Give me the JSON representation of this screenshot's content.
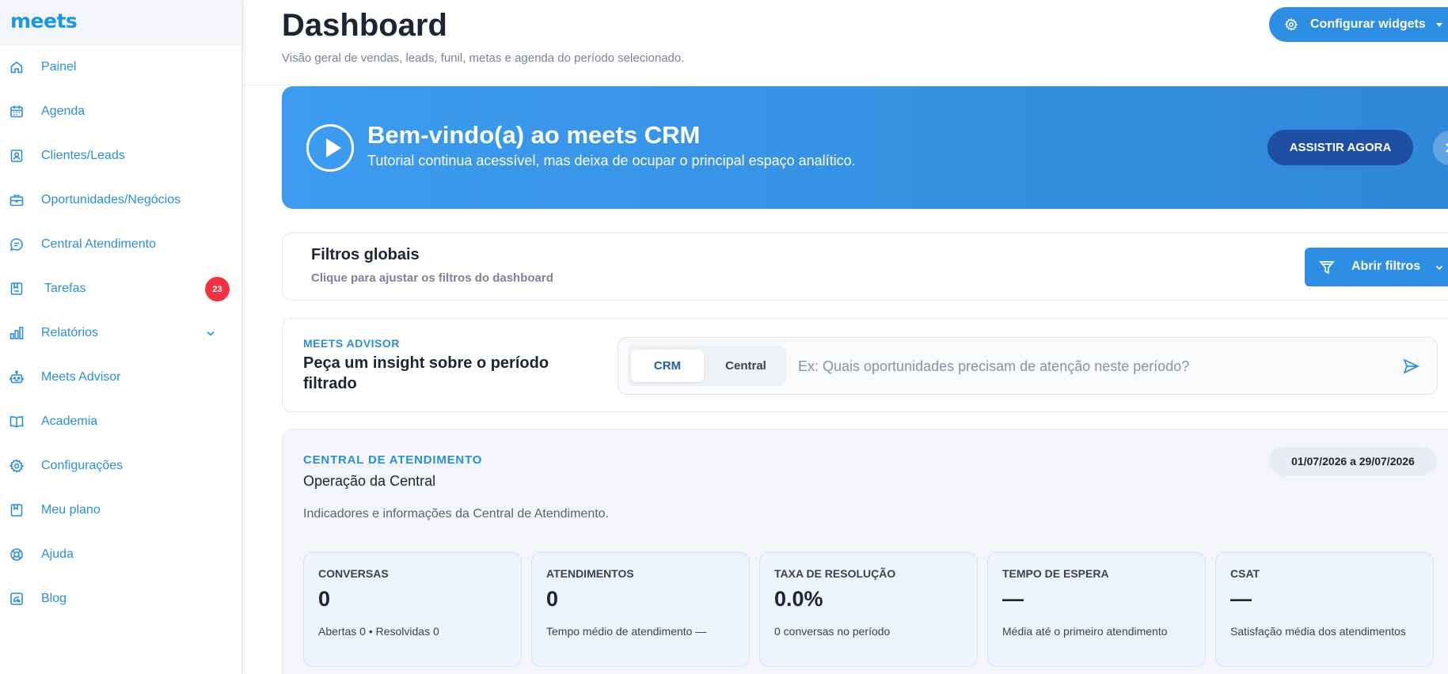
{
  "app": {
    "logo": "meets"
  },
  "sidebar": {
    "items": [
      {
        "label": "Painel",
        "icon": "home-icon"
      },
      {
        "label": "Agenda",
        "icon": "calendar-icon"
      },
      {
        "label": "Clientes/Leads",
        "icon": "contact-card-icon"
      },
      {
        "label": "Oportunidades/Negócios",
        "icon": "briefcase-icon"
      },
      {
        "label": "Central Atendimento",
        "icon": "chat-icon"
      },
      {
        "label": "Tarefas",
        "icon": "task-icon",
        "badge": "23"
      },
      {
        "label": "Relatórios",
        "icon": "bar-chart-icon"
      },
      {
        "label": "Meets Advisor",
        "icon": "robot-icon"
      },
      {
        "label": "Academia",
        "icon": "book-icon"
      },
      {
        "label": "Configurações",
        "icon": "gear-icon"
      },
      {
        "label": "Meu plano",
        "icon": "bookmark-icon"
      },
      {
        "label": "Ajuda",
        "icon": "lifebuoy-icon"
      },
      {
        "label": "Blog",
        "icon": "blog-icon"
      }
    ]
  },
  "header": {
    "title": "Dashboard",
    "subtitle": "Visão geral de vendas, leads, funil, metas e agenda do período selecionado.",
    "config_label": "Configurar widgets"
  },
  "banner": {
    "title": "Bem-vindo(a) ao meets CRM",
    "subtitle": "Tutorial continua acessível, mas deixa de ocupar o principal espaço analítico.",
    "watch_label": "ASSISTIR AGORA"
  },
  "filters": {
    "title": "Filtros globais",
    "subtitle": "Clique para ajustar os filtros do dashboard",
    "button_label": "Abrir filtros"
  },
  "advisor": {
    "kicker": "MEETS ADVISOR",
    "question": "Peça um insight sobre o período filtrado",
    "tab_crm": "CRM",
    "tab_central": "Central",
    "placeholder": "Ex: Quais oportunidades precisam de atenção neste período?"
  },
  "central": {
    "kicker": "CENTRAL DE ATENDIMENTO",
    "title": "Operação da Central",
    "description": "Indicadores e informações da Central de Atendimento.",
    "date_range": "01/07/2026 a 29/07/2026",
    "cards": [
      {
        "label": "CONVERSAS",
        "value": "0",
        "sub": "Abertas 0 • Resolvidas 0"
      },
      {
        "label": "ATENDIMENTOS",
        "value": "0",
        "sub": "Tempo médio de atendimento —"
      },
      {
        "label": "TAXA DE RESOLUÇÃO",
        "value": "0.0%",
        "sub": "0 conversas no período"
      },
      {
        "label": "TEMPO DE ESPERA",
        "value": "—",
        "sub": "Média até o primeiro atendimento"
      },
      {
        "label": "CSAT",
        "value": "—",
        "sub": "Satisfação média dos atendimentos"
      }
    ]
  },
  "colors": {
    "accent": "#2d8ee3",
    "banner_start": "#3d9cef",
    "banner_button": "#1e4fa3",
    "badge": "#ef3340"
  }
}
